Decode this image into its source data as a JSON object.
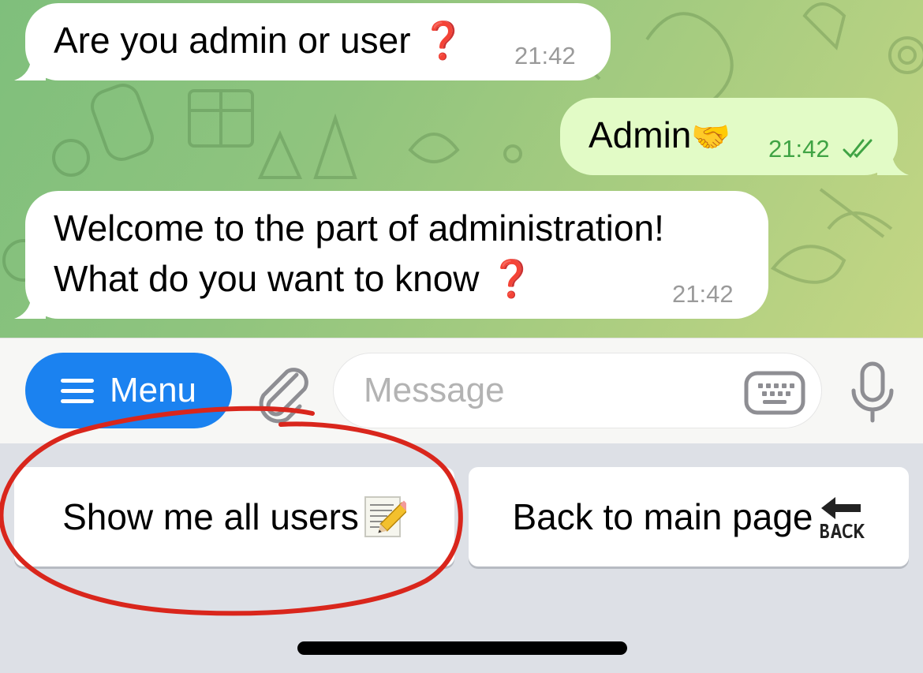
{
  "messages": [
    {
      "direction": "incoming",
      "text": "Are you admin or user",
      "emoji": "❓",
      "time": "21:42"
    },
    {
      "direction": "outgoing",
      "text": "Admin",
      "emoji": "🤝",
      "time": "21:42",
      "status": "read"
    },
    {
      "direction": "incoming",
      "line1": "Welcome to the part of administration!",
      "line2": "What do you want to know",
      "emoji": "❓",
      "time": "21:42"
    }
  ],
  "input_bar": {
    "menu_label": "Menu",
    "placeholder": "Message"
  },
  "reply_keyboard": [
    {
      "label": "Show me all users",
      "emoji": "📝"
    },
    {
      "label": "Back to main page",
      "emoji": "🔙"
    }
  ],
  "colors": {
    "accent": "#1b82f0",
    "outgoing_bubble": "#e2fbc6",
    "incoming_bubble": "#ffffff",
    "annotation": "#d9261c",
    "read_check": "#3fa344"
  }
}
